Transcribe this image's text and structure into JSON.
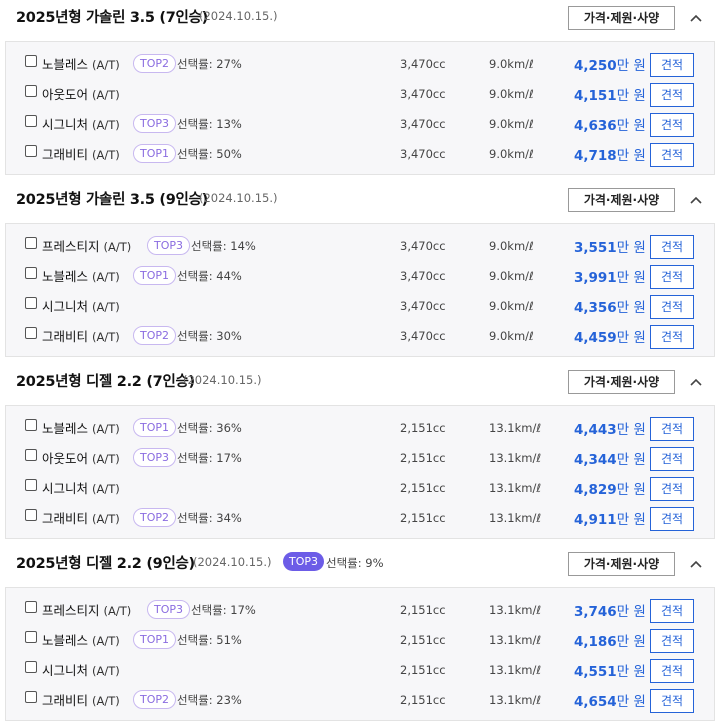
{
  "spec_button_label": "가격·제원·사양",
  "quote_label": "견적",
  "price_unit": "만 원",
  "sections": [
    {
      "title": "2025년형 가솔린 3.5 (7인승)",
      "date": "(2024.10.15.)",
      "badge": null,
      "badge_rate": null,
      "rows": [
        {
          "trim": "노블레스",
          "trans": "(A/T)",
          "badge": "TOP2",
          "rate": "선택률: 27%",
          "cc": "3,470cc",
          "eff": "9.0km/ℓ",
          "price": "4,250"
        },
        {
          "trim": "아웃도어",
          "trans": "(A/T)",
          "badge": null,
          "rate": null,
          "cc": "3,470cc",
          "eff": "9.0km/ℓ",
          "price": "4,151"
        },
        {
          "trim": "시그니처",
          "trans": "(A/T)",
          "badge": "TOP3",
          "rate": "선택률: 13%",
          "cc": "3,470cc",
          "eff": "9.0km/ℓ",
          "price": "4,636"
        },
        {
          "trim": "그래비티",
          "trans": "(A/T)",
          "badge": "TOP1",
          "rate": "선택률: 50%",
          "cc": "3,470cc",
          "eff": "9.0km/ℓ",
          "price": "4,718"
        }
      ]
    },
    {
      "title": "2025년형 가솔린 3.5 (9인승)",
      "date": "(2024.10.15.)",
      "badge": null,
      "badge_rate": null,
      "rows": [
        {
          "trim": "프레스티지",
          "trans": "(A/T)",
          "badge": "TOP3",
          "rate": "선택률: 14%",
          "cc": "3,470cc",
          "eff": "9.0km/ℓ",
          "price": "3,551"
        },
        {
          "trim": "노블레스",
          "trans": "(A/T)",
          "badge": "TOP1",
          "rate": "선택률: 44%",
          "cc": "3,470cc",
          "eff": "9.0km/ℓ",
          "price": "3,991"
        },
        {
          "trim": "시그니처",
          "trans": "(A/T)",
          "badge": null,
          "rate": null,
          "cc": "3,470cc",
          "eff": "9.0km/ℓ",
          "price": "4,356"
        },
        {
          "trim": "그래비티",
          "trans": "(A/T)",
          "badge": "TOP2",
          "rate": "선택률: 30%",
          "cc": "3,470cc",
          "eff": "9.0km/ℓ",
          "price": "4,459"
        }
      ]
    },
    {
      "title": "2025년형 디젤 2.2 (7인승)",
      "date": "(2024.10.15.)",
      "badge": null,
      "badge_rate": null,
      "rows": [
        {
          "trim": "노블레스",
          "trans": "(A/T)",
          "badge": "TOP1",
          "rate": "선택률: 36%",
          "cc": "2,151cc",
          "eff": "13.1km/ℓ",
          "price": "4,443"
        },
        {
          "trim": "아웃도어",
          "trans": "(A/T)",
          "badge": "TOP3",
          "rate": "선택률: 17%",
          "cc": "2,151cc",
          "eff": "13.1km/ℓ",
          "price": "4,344"
        },
        {
          "trim": "시그니처",
          "trans": "(A/T)",
          "badge": null,
          "rate": null,
          "cc": "2,151cc",
          "eff": "13.1km/ℓ",
          "price": "4,829"
        },
        {
          "trim": "그래비티",
          "trans": "(A/T)",
          "badge": "TOP2",
          "rate": "선택률: 34%",
          "cc": "2,151cc",
          "eff": "13.1km/ℓ",
          "price": "4,911"
        }
      ]
    },
    {
      "title": "2025년형 디젤 2.2 (9인승)",
      "date": "(2024.10.15.)",
      "badge": "TOP3",
      "badge_rate": "선택률: 9%",
      "rows": [
        {
          "trim": "프레스티지",
          "trans": "(A/T)",
          "badge": "TOP3",
          "rate": "선택률: 17%",
          "cc": "2,151cc",
          "eff": "13.1km/ℓ",
          "price": "3,746"
        },
        {
          "trim": "노블레스",
          "trans": "(A/T)",
          "badge": "TOP1",
          "rate": "선택률: 51%",
          "cc": "2,151cc",
          "eff": "13.1km/ℓ",
          "price": "4,186"
        },
        {
          "trim": "시그니처",
          "trans": "(A/T)",
          "badge": null,
          "rate": null,
          "cc": "2,151cc",
          "eff": "13.1km/ℓ",
          "price": "4,551"
        },
        {
          "trim": "그래비티",
          "trans": "(A/T)",
          "badge": "TOP2",
          "rate": "선택률: 23%",
          "cc": "2,151cc",
          "eff": "13.1km/ℓ",
          "price": "4,654"
        }
      ]
    }
  ]
}
